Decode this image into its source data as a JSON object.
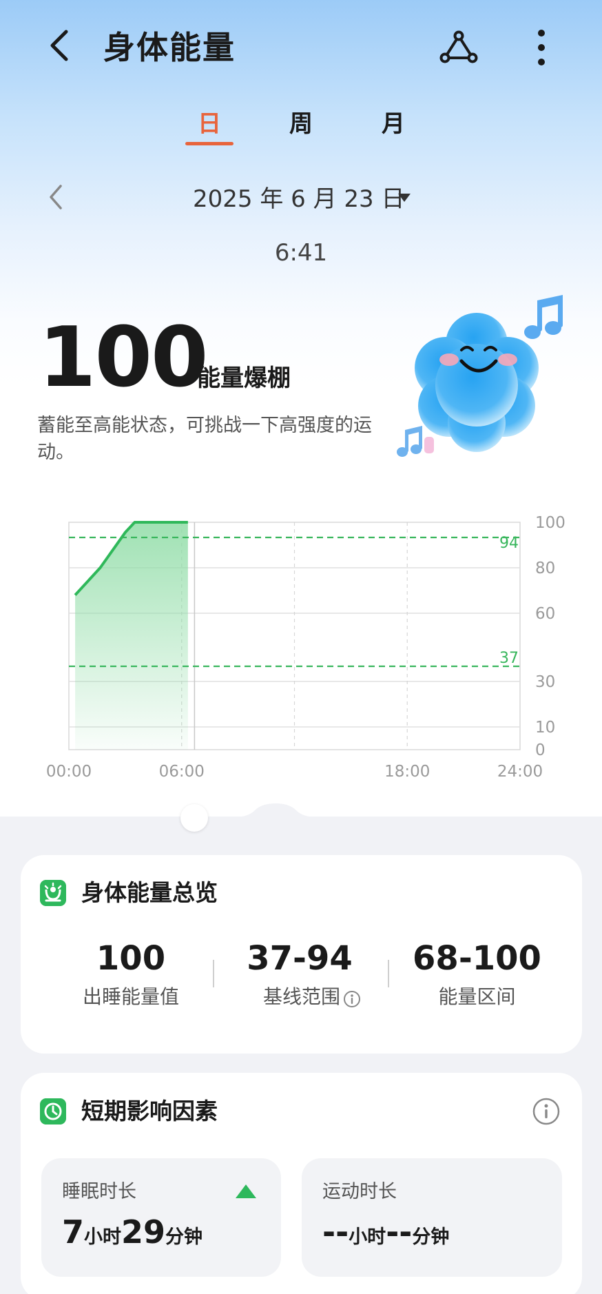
{
  "header": {
    "title": "身体能量"
  },
  "tabs": [
    {
      "label": "日"
    },
    {
      "label": "周"
    },
    {
      "label": "月"
    }
  ],
  "active_tab": "日",
  "date": {
    "label": "2025 年 6 月 23 日",
    "time": "6:41"
  },
  "energy": {
    "value": "100",
    "status": "能量爆棚",
    "description": "蓄能至高能状态，可挑战一下高强度的运动。"
  },
  "chart_data": {
    "type": "area",
    "x_ticks": [
      "00:00",
      "06:00",
      "",
      "18:00",
      "24:00"
    ],
    "y_ticks": [
      "100",
      "80",
      "60",
      "30",
      "10",
      "0"
    ],
    "ylim": [
      0,
      100
    ],
    "xlim": [
      "00:00",
      "24:00"
    ],
    "series": [
      {
        "x": [
          "00:20",
          "01:40",
          "03:00",
          "03:30",
          "06:20"
        ],
        "y": [
          68,
          80,
          96,
          100,
          100
        ]
      }
    ],
    "baseline_lines": [
      {
        "value": 94,
        "label": "94"
      },
      {
        "value": 37,
        "label": "37"
      }
    ],
    "current_time": "06:41",
    "grid": true,
    "colors": {
      "line": "#2fb85a",
      "fill": "#8fdca6",
      "baseline": "#38b65c"
    }
  },
  "overview": {
    "title": "身体能量总览",
    "stats": [
      {
        "value": "100",
        "label": "出睡能量值"
      },
      {
        "value": "37-94",
        "label": "基线范围"
      },
      {
        "value": "68-100",
        "label": "能量区间"
      }
    ]
  },
  "factors": {
    "title": "短期影响因素",
    "items": [
      {
        "label": "睡眠时长",
        "hours": "7",
        "hour_unit": "小时",
        "minutes": "29",
        "minute_unit": "分钟",
        "trend": "up"
      },
      {
        "label": "运动时长",
        "hours": "--",
        "hour_unit": "小时",
        "minutes": "--",
        "minute_unit": "分钟"
      }
    ]
  },
  "colors": {
    "accent": "#e8643c",
    "green": "#2eb85c",
    "text": "#1a1a1a"
  }
}
